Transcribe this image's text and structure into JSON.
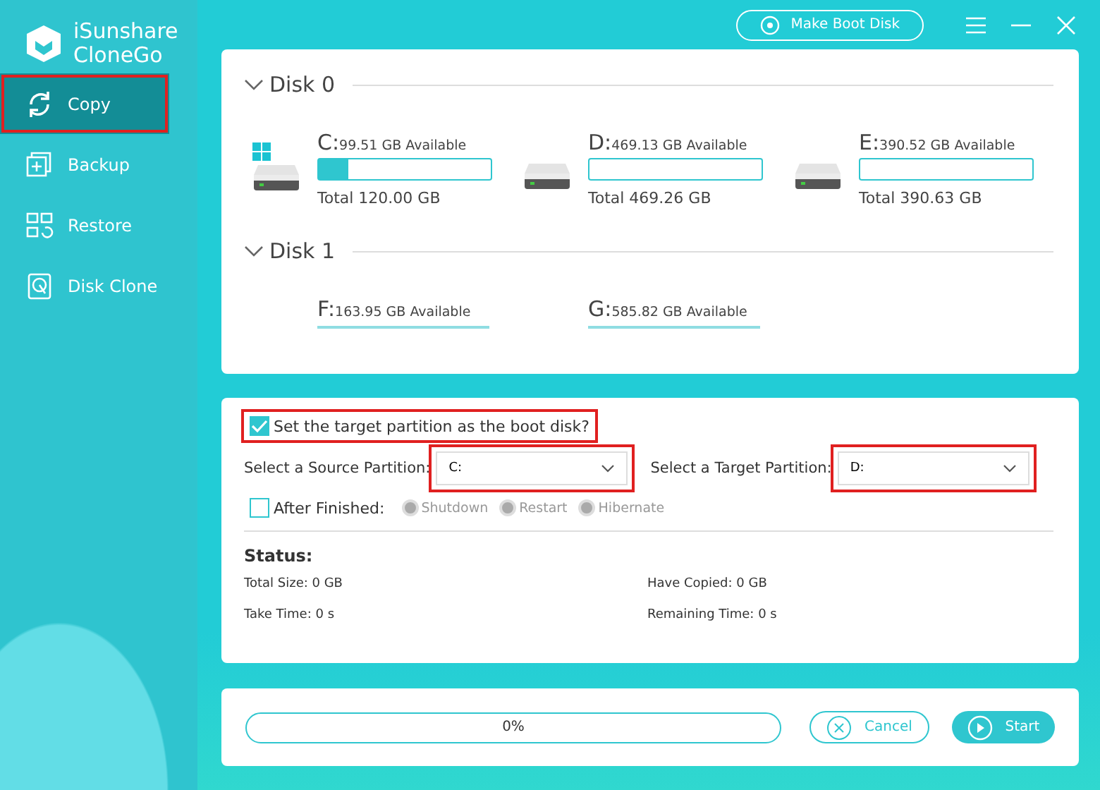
{
  "app": {
    "name_line1": "iSunshare",
    "name_line2": "CloneGo"
  },
  "sidebar": {
    "items": [
      {
        "label": "Copy",
        "selected": true,
        "highlighted": true
      },
      {
        "label": "Backup",
        "selected": false,
        "highlighted": false
      },
      {
        "label": "Restore",
        "selected": false,
        "highlighted": false
      },
      {
        "label": "Disk Clone",
        "selected": false,
        "highlighted": false
      }
    ]
  },
  "toolbar": {
    "boot_button": "Make Boot Disk"
  },
  "disks": [
    {
      "title": "Disk 0",
      "expanded": true,
      "partitions": [
        {
          "kind": "system",
          "letter": "C:",
          "available": "99.51 GB Available",
          "level": 0.17,
          "total": "Total 120.00 GB"
        },
        {
          "kind": "drive",
          "letter": "D:",
          "available": "469.13 GB Available",
          "level": 0.0,
          "total": "Total 469.26 GB"
        },
        {
          "kind": "drive",
          "letter": "E:",
          "available": "390.52 GB Available",
          "level": 0.0,
          "total": "Total 390.63 GB"
        }
      ]
    },
    {
      "title": "Disk 1",
      "expanded": true,
      "partitions": [
        {
          "kind": "plain",
          "letter": "F:",
          "available": "163.95 GB Available"
        },
        {
          "kind": "plain",
          "letter": "G:",
          "available": "585.82 GB Available"
        }
      ]
    }
  ],
  "options": {
    "boot_checkbox": {
      "label": "Set the target partition as the boot disk?",
      "checked": true,
      "highlighted": true
    },
    "source": {
      "label": "Select a Source Partition:",
      "value": "C:",
      "highlighted": true
    },
    "target": {
      "label": "Select a Target Partition:",
      "value": "D:",
      "highlighted": true
    },
    "after": {
      "label": "After Finished:",
      "checked": false
    },
    "after_options": [
      {
        "label": "Shutdown",
        "disabled": true
      },
      {
        "label": "Restart",
        "disabled": true
      },
      {
        "label": "Hibernate",
        "disabled": true
      }
    ]
  },
  "status": {
    "title": "Status:",
    "items": [
      "Total Size: 0 GB",
      "Have Copied: 0 GB",
      "Take Time: 0 s",
      "Remaining Time: 0 s"
    ]
  },
  "footer": {
    "progress": {
      "level": 0,
      "text": "0%"
    },
    "cancel": "Cancel",
    "start": "Start"
  }
}
